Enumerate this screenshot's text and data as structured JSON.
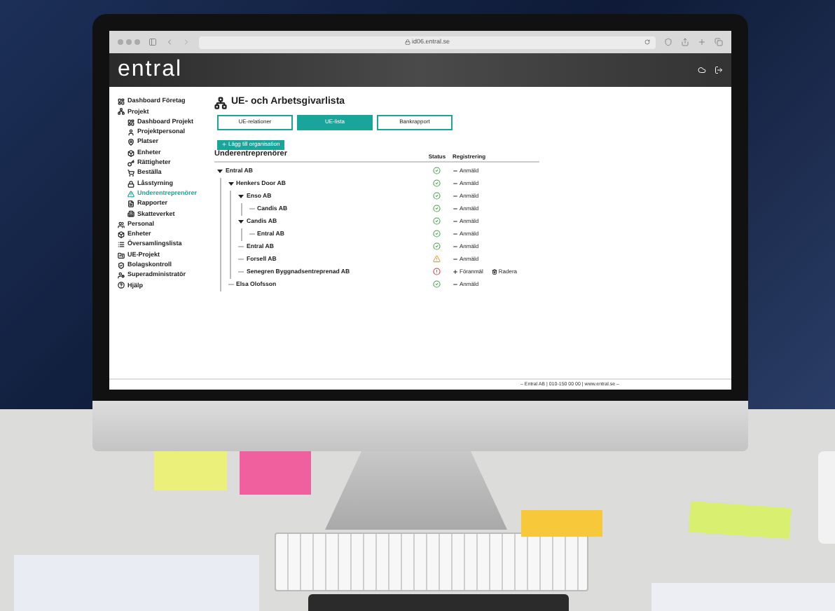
{
  "browser": {
    "url": "id06.entral.se"
  },
  "app": {
    "logo": "entral"
  },
  "sidebar": {
    "items": [
      {
        "label": "Dashboard Företag",
        "selected": false
      },
      {
        "label": "Projekt",
        "selected": false,
        "children": [
          {
            "label": "Dashboard Projekt",
            "selected": false
          },
          {
            "label": "Projektpersonal",
            "selected": false
          },
          {
            "label": "Platser",
            "selected": false
          },
          {
            "label": "Enheter",
            "selected": false
          },
          {
            "label": "Rättigheter",
            "selected": false
          },
          {
            "label": "Beställa",
            "selected": false
          },
          {
            "label": "Låsstyrning",
            "selected": false
          },
          {
            "label": "Underentreprenörer",
            "selected": true
          },
          {
            "label": "Rapporter",
            "selected": false
          },
          {
            "label": "Skatteverket",
            "selected": false
          }
        ]
      },
      {
        "label": "Personal",
        "selected": false
      },
      {
        "label": "Enheter",
        "selected": false
      },
      {
        "label": "Översamlingslista",
        "selected": false
      },
      {
        "label": "UE-Projekt",
        "selected": false
      },
      {
        "label": "Bolagskontroll",
        "selected": false
      },
      {
        "label": "Superadministratör",
        "selected": false
      },
      {
        "label": "Hjälp",
        "selected": false
      }
    ]
  },
  "page": {
    "title": "UE- och Arbetsgivarlista",
    "tabs": [
      {
        "label": "UE-relationer",
        "selected": false
      },
      {
        "label": "UE-lista",
        "selected": true
      },
      {
        "label": "Bankrapport",
        "selected": false
      }
    ],
    "add_button": "Lägg till organisation",
    "table": {
      "title": "Underentreprenörer",
      "columns": [
        "Status",
        "Registrering"
      ],
      "rows": [
        {
          "name": "Entral AB",
          "expanded": true,
          "status": {
            "kind": "ok"
          },
          "registration": {
            "kind": "registered",
            "label": "Anmäld"
          },
          "children": [
            {
              "name": "Henkers Door AB",
              "expanded": true,
              "status": {
                "kind": "ok"
              },
              "registration": {
                "kind": "registered",
                "label": "Anmäld"
              },
              "children": [
                {
                  "name": "Enso AB",
                  "expanded": true,
                  "status": {
                    "kind": "ok"
                  },
                  "registration": {
                    "kind": "registered",
                    "label": "Anmäld"
                  },
                  "children": [
                    {
                      "name": "Candis AB",
                      "status": {
                        "kind": "ok"
                      },
                      "registration": {
                        "kind": "registered",
                        "label": "Anmäld"
                      }
                    }
                  ]
                },
                {
                  "name": "Candis AB",
                  "expanded": true,
                  "status": {
                    "kind": "ok"
                  },
                  "registration": {
                    "kind": "registered",
                    "label": "Anmäld"
                  },
                  "children": [
                    {
                      "name": "Entral AB",
                      "status": {
                        "kind": "ok"
                      },
                      "registration": {
                        "kind": "registered",
                        "label": "Anmäld"
                      }
                    }
                  ]
                },
                {
                  "name": "Entral AB",
                  "status": {
                    "kind": "ok"
                  },
                  "registration": {
                    "kind": "registered",
                    "label": "Anmäld"
                  }
                },
                {
                  "name": "Forsell AB",
                  "status": {
                    "kind": "warning"
                  },
                  "registration": {
                    "kind": "registered",
                    "label": "Anmäld"
                  }
                },
                {
                  "name": "Senegren Byggnadsentreprenad AB",
                  "status": {
                    "kind": "error"
                  },
                  "registration": {
                    "kind": "pending",
                    "label": "Föranmäl"
                  },
                  "action": "Radera"
                }
              ]
            },
            {
              "name": "Elsa Olofsson",
              "status": {
                "kind": "ok"
              },
              "registration": {
                "kind": "registered",
                "label": "Anmäld"
              }
            }
          ]
        }
      ]
    }
  },
  "footer": "– Entral AB | 010-150 00 00 | www.entral.se –"
}
